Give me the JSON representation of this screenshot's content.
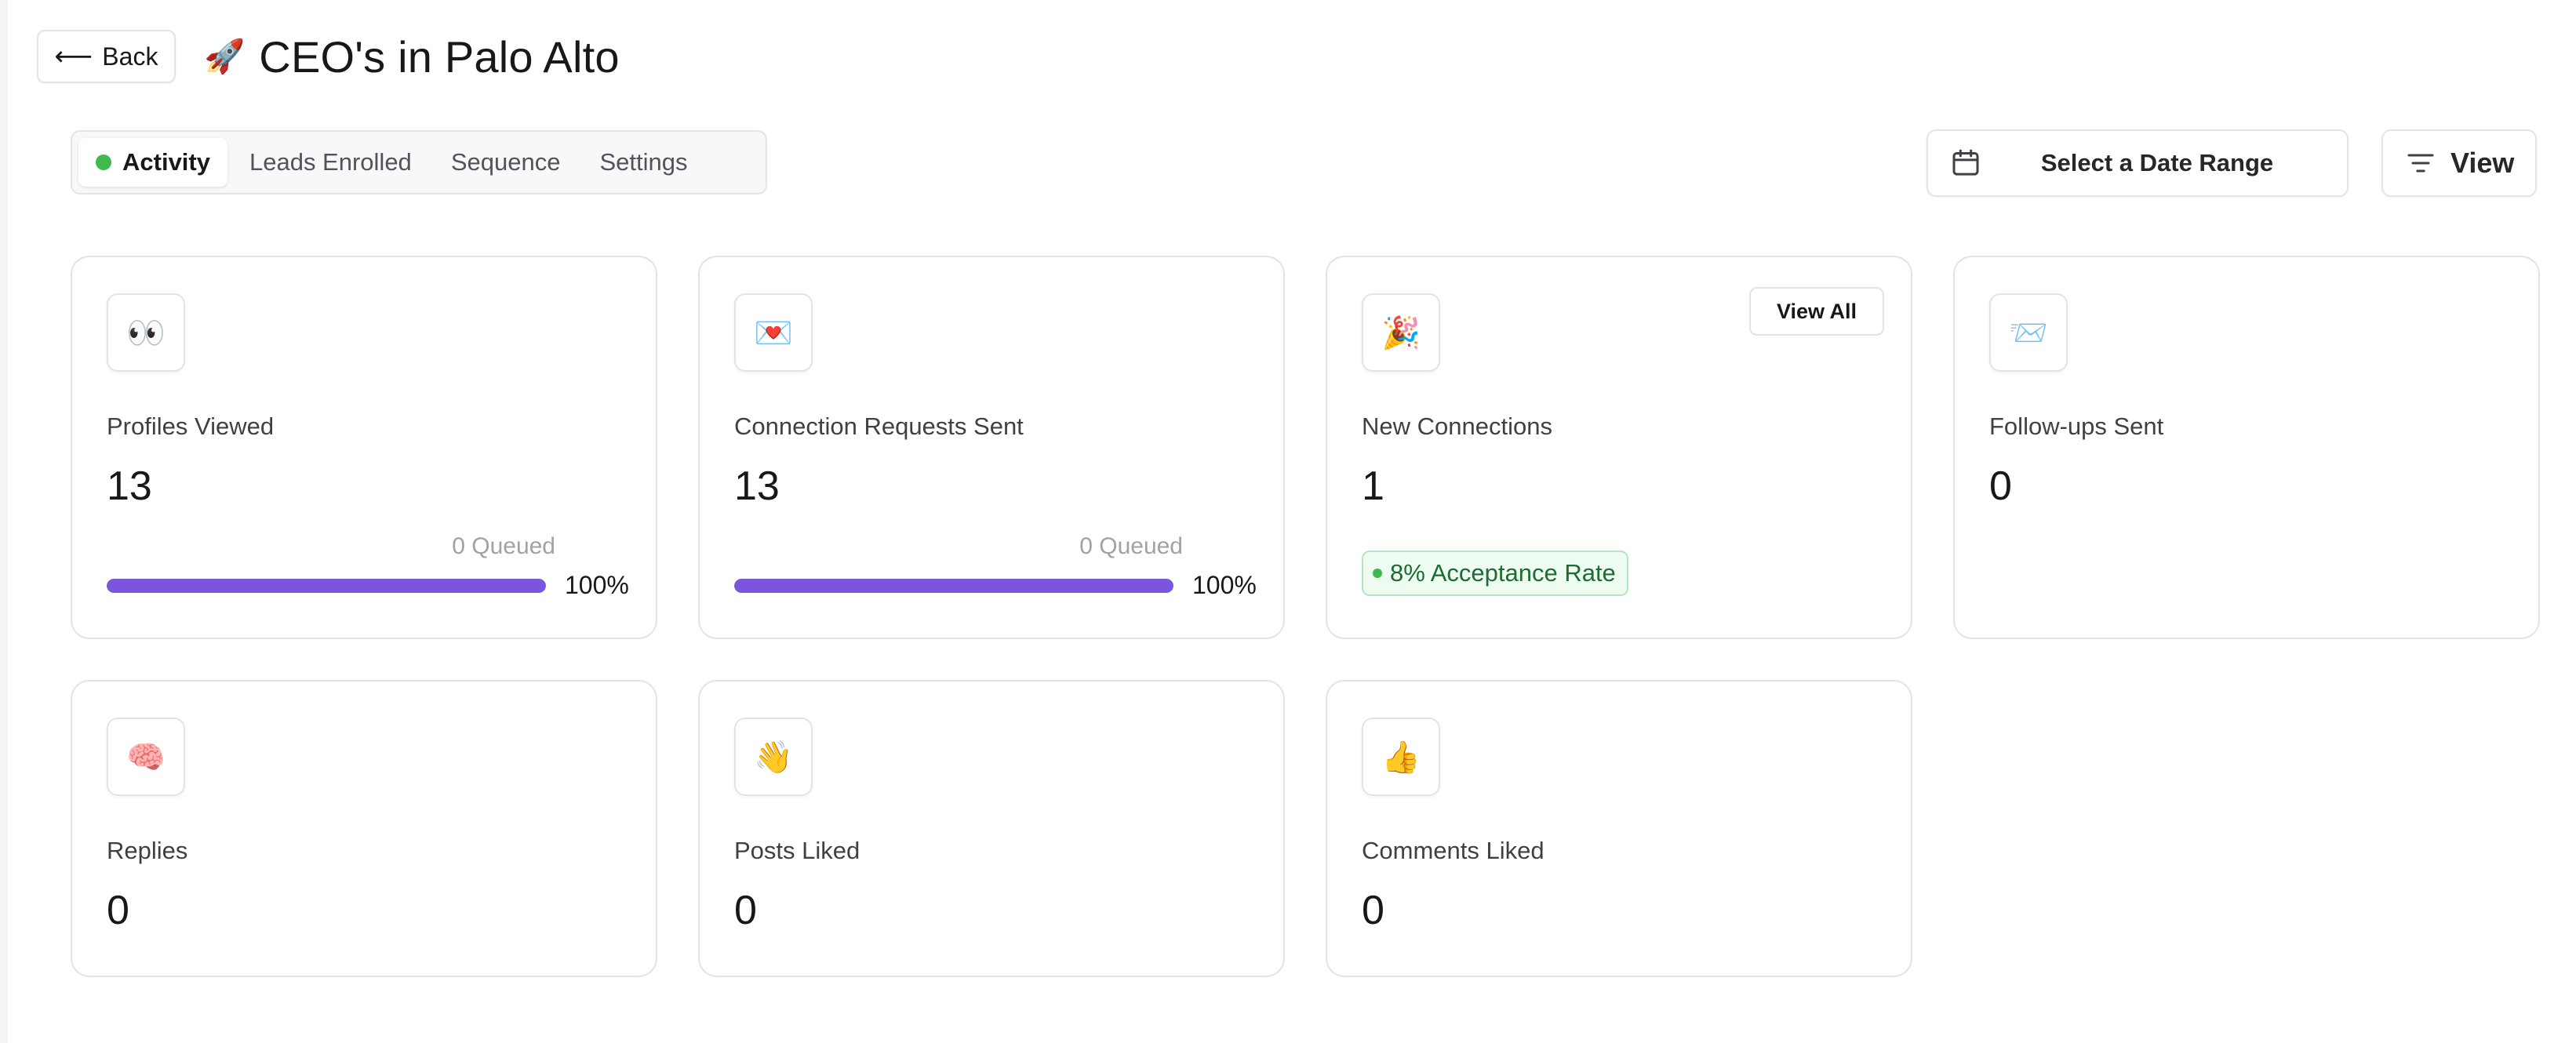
{
  "header": {
    "back_label": "Back",
    "back_arrow": "⟵",
    "title_emoji": "🚀",
    "title": "CEO's in Palo Alto"
  },
  "tabs": [
    {
      "label": "Activity",
      "active": true,
      "status_color": "#3fb950"
    },
    {
      "label": "Leads Enrolled",
      "active": false
    },
    {
      "label": "Sequence",
      "active": false
    },
    {
      "label": "Settings",
      "active": false
    }
  ],
  "controls": {
    "date_range_label": "Select a Date Range",
    "date_icon": "calendar-icon",
    "view_label": "View",
    "view_icon": "filter-lines-icon"
  },
  "colors": {
    "progress": "#7b55dd",
    "success": "#3fb950"
  },
  "cards": {
    "profiles_viewed": {
      "emoji": "👀",
      "label": "Profiles Viewed",
      "value": "13",
      "queued": "0 Queued",
      "progress_percent": 100,
      "percent_label": "100%"
    },
    "connection_requests": {
      "emoji": "💌",
      "label": "Connection Requests Sent",
      "value": "13",
      "queued": "0 Queued",
      "progress_percent": 100,
      "percent_label": "100%"
    },
    "new_connections": {
      "emoji": "🎉",
      "label": "New Connections",
      "value": "1",
      "view_all_label": "View All",
      "acceptance_rate": "8% Acceptance Rate"
    },
    "followups_sent": {
      "emoji": "📨",
      "label": "Follow-ups Sent",
      "value": "0"
    },
    "replies": {
      "emoji": "🧠",
      "label": "Replies",
      "value": "0"
    },
    "posts_liked": {
      "emoji": "👋",
      "label": "Posts Liked",
      "value": "0"
    },
    "comments_liked": {
      "emoji": "👍",
      "label": "Comments Liked",
      "value": "0"
    }
  }
}
